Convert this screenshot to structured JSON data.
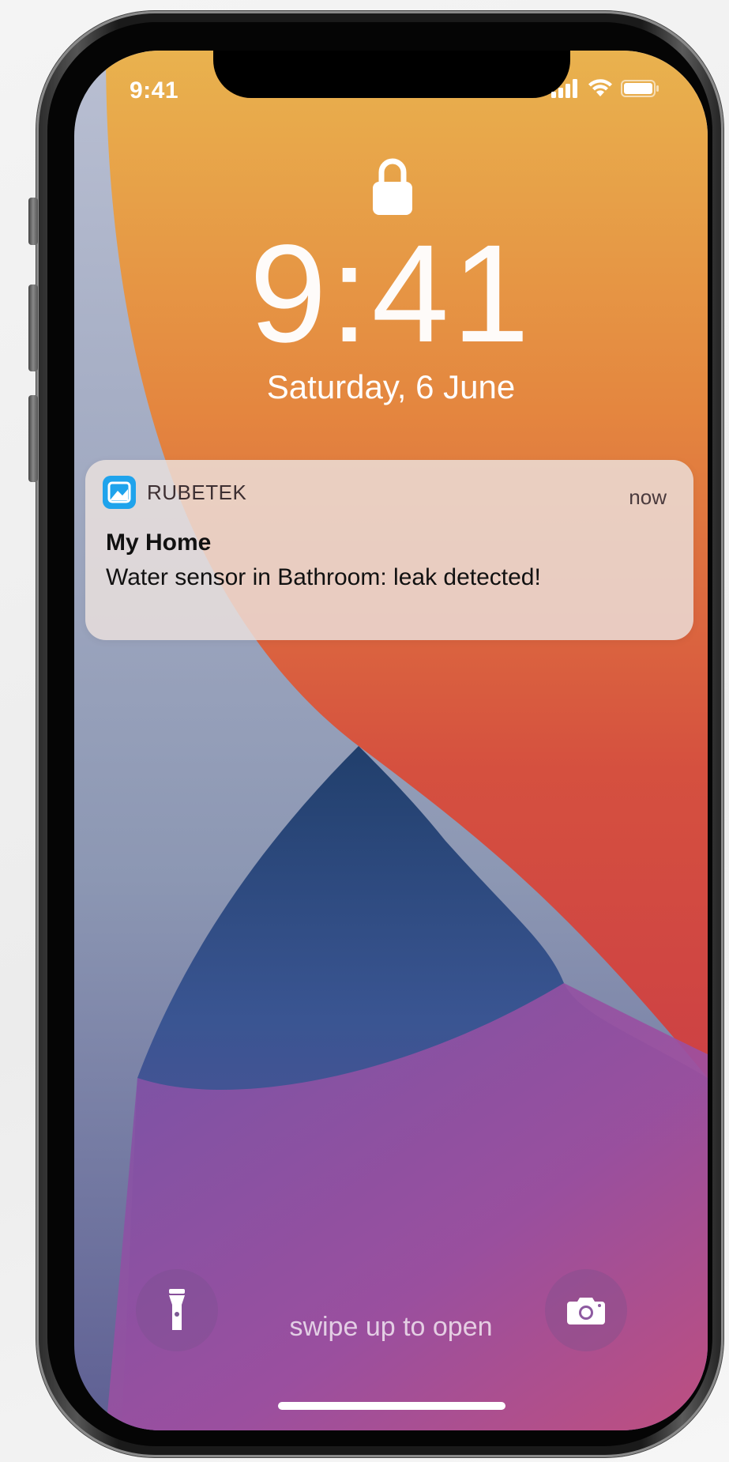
{
  "status_bar": {
    "time": "9:41",
    "icons": [
      "signal-icon",
      "wifi-icon",
      "battery-icon"
    ]
  },
  "lock_screen": {
    "lock_icon": "lock-icon",
    "time": "9:41",
    "date": "Saturday, 6 June"
  },
  "notification": {
    "app_name": "RUBETEK",
    "app_icon": "rubetek-app-icon",
    "time": "now",
    "title": "My Home",
    "body": "Water sensor in Bathroom: leak detected!"
  },
  "bottom": {
    "flashlight_icon": "flashlight-icon",
    "camera_icon": "camera-icon",
    "swipe_text": "swipe up to open"
  },
  "colors": {
    "wallpaper_orange": "#e58a3e",
    "wallpaper_red": "#d04a3e",
    "wallpaper_blue": "#2e4f86",
    "wallpaper_purple": "#9b52a8",
    "wallpaper_grey": "#a6aec4",
    "app_icon_blue": "#1fa3ec"
  }
}
